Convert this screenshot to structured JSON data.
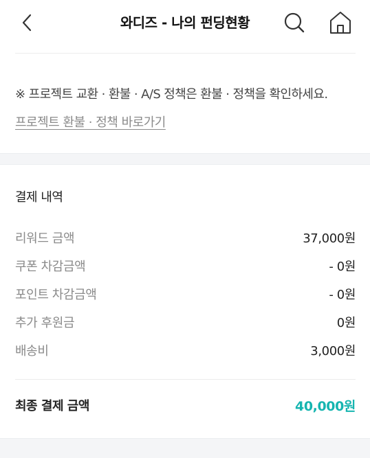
{
  "header": {
    "title": "와디즈 - 나의 펀딩현황"
  },
  "policy": {
    "note": "※ 프로젝트 교환 · 환불 · A/S 정책은 환불 · 정책을 확인하세요.",
    "link": "프로젝트 환불 · 정책 바로가기"
  },
  "payment": {
    "title": "결제 내역",
    "rows": [
      {
        "label": "리워드 금액",
        "value": "37,000원"
      },
      {
        "label": "쿠폰 차감금액",
        "value": "- 0원"
      },
      {
        "label": "포인트 차감금액",
        "value": "- 0원"
      },
      {
        "label": "추가 후원금",
        "value": "0원"
      },
      {
        "label": "배송비",
        "value": "3,000원"
      }
    ],
    "total_label": "최종 결제 금액",
    "total_value": "40,000원"
  },
  "colors": {
    "accent": "#16b5b0"
  }
}
